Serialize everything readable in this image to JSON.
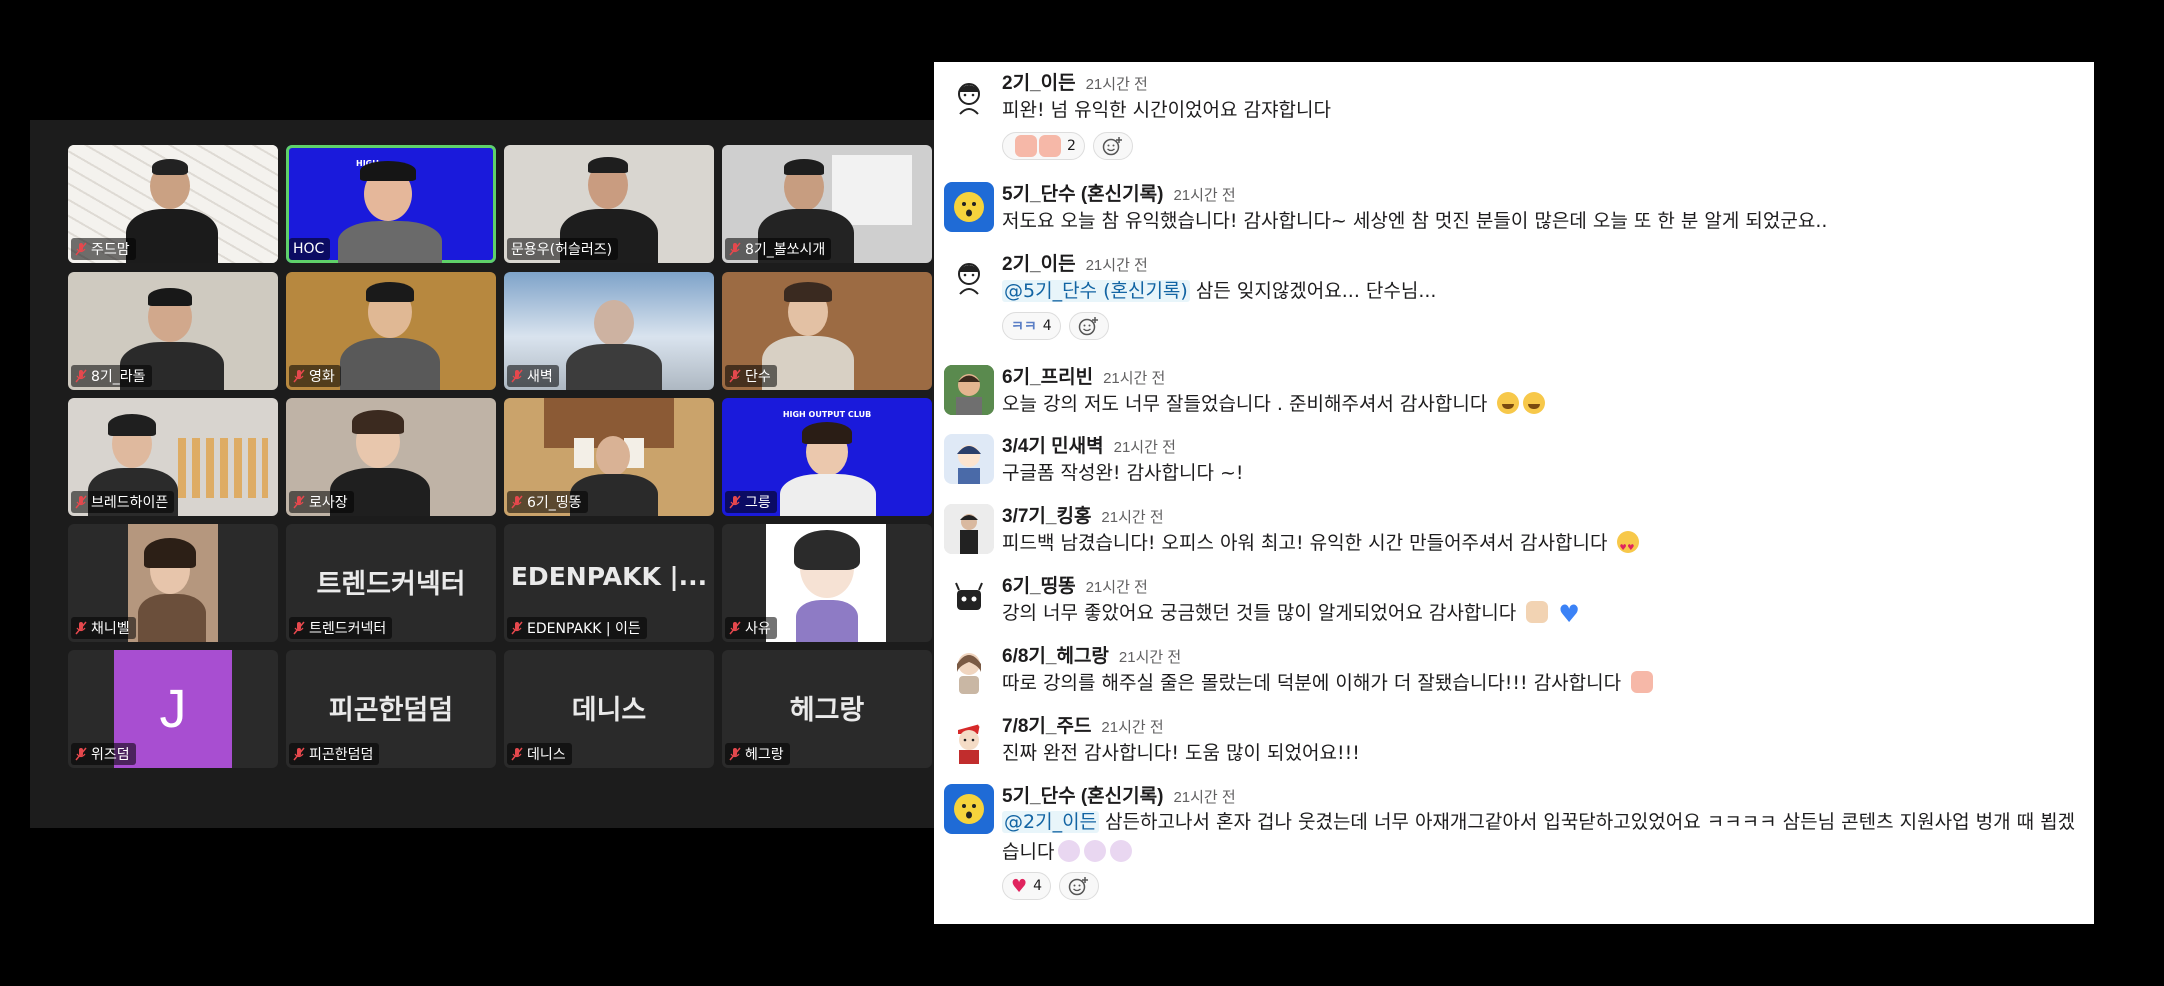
{
  "meeting": {
    "tiles": [
      {
        "name": "주드맘",
        "big": "",
        "muted": true
      },
      {
        "name": "HOC",
        "big": "",
        "muted": false,
        "active": true
      },
      {
        "name": "문용우(허슬러즈)",
        "big": "",
        "muted": false
      },
      {
        "name": "8기_볼쏘시개",
        "big": "",
        "muted": true
      },
      {
        "name": "8기_라돌",
        "big": "",
        "muted": true
      },
      {
        "name": "영화",
        "big": "",
        "muted": true
      },
      {
        "name": "새벽",
        "big": "",
        "muted": true
      },
      {
        "name": "단수",
        "big": "",
        "muted": true
      },
      {
        "name": "브레드하이픈",
        "big": "",
        "muted": true
      },
      {
        "name": "로사장",
        "big": "",
        "muted": true
      },
      {
        "name": "6기_띵똥",
        "big": "",
        "muted": true
      },
      {
        "name": "그릉",
        "big": "",
        "muted": true
      },
      {
        "name": "채니벨",
        "big": "",
        "muted": true
      },
      {
        "name": "트렌드커넥터",
        "big": "트렌드커넥터",
        "muted": true
      },
      {
        "name": "EDENPAKK | 이든",
        "big": "EDENPAKK |...",
        "muted": true
      },
      {
        "name": "사유",
        "big": "",
        "muted": true
      },
      {
        "name": "위즈덤",
        "big": "J",
        "muted": true
      },
      {
        "name": "피곤한덤덤",
        "big": "피곤한덤덤",
        "muted": true
      },
      {
        "name": "데니스",
        "big": "데니스",
        "muted": true
      },
      {
        "name": "헤그랑",
        "big": "헤그랑",
        "muted": true
      }
    ],
    "banner_text": "HIGH OUTPUT CLUB",
    "banner_text_short": "HIGH"
  },
  "chat": {
    "messages": [
      {
        "author": "2기_이든",
        "time": "21시간 전",
        "text": "피완! 넘 유익한 시간이었어요 감쟈합니다",
        "react_count": "2"
      },
      {
        "author": "5기_단수 (혼신기록)",
        "time": "21시간 전",
        "text": "저도요 오늘 참 유익했습니다! 감사합니다~ 세상엔 참 멋진 분들이 많은데 오늘 또 한 분 알게 되었군요.."
      },
      {
        "author": "2기_이든",
        "time": "21시간 전",
        "mention": "@5기_단수 (혼신기록)",
        "text": " 삼든 잊지않겠어요... 단수님...",
        "react_label": "ㅋㅋ",
        "react_count": "4"
      },
      {
        "author": "6기_프리빈",
        "time": "21시간 전",
        "text": "오늘 강의 저도 너무 잘들었습니다 . 준비해주셔서 감사합니다"
      },
      {
        "author": "3/4기 민새벽",
        "time": "21시간 전",
        "text": "구글폼 작성완! 감사합니다 ~!"
      },
      {
        "author": "3/7기_킹홍",
        "time": "21시간 전",
        "text": "피드백 남겼습니다! 오피스 아워 최고! 유익한 시간 만들어주셔서 감사합니다"
      },
      {
        "author": "6기_띵똥",
        "time": "21시간 전",
        "text": "강의 너무 좋았어요 궁금했던 것들 많이 알게되었어요 감사합니다"
      },
      {
        "author": "6/8기_헤그랑",
        "time": "21시간 전",
        "text": "따로 강의를 해주실 줄은 몰랐는데 덕분에 이해가 더 잘됐습니다!!! 감사합니다"
      },
      {
        "author": "7/8기_주드",
        "time": "21시간 전",
        "text": "진짜 완전 감사합니다! 도움 많이 되었어요!!!"
      },
      {
        "author": "5기_단수 (혼신기록)",
        "time": "21시간 전",
        "mention": "@2기_이든",
        "text": " 삼든하고나서 혼자 겁나 웃겼는데 너무 아재개그같아서 입꾹닫하고있었어요 ㅋㅋㅋㅋ 삼든님 콘텐츠 지원사업 벙개 때 뵙겠습니다",
        "react_count": "4"
      }
    ]
  },
  "colors": {
    "active_tile": "#5fd16a",
    "mention_bg": "#e8f5fa",
    "mention_fg": "#1264a3",
    "banner_blue": "#1a1adb",
    "avatar_purple": "#a84ed1"
  }
}
